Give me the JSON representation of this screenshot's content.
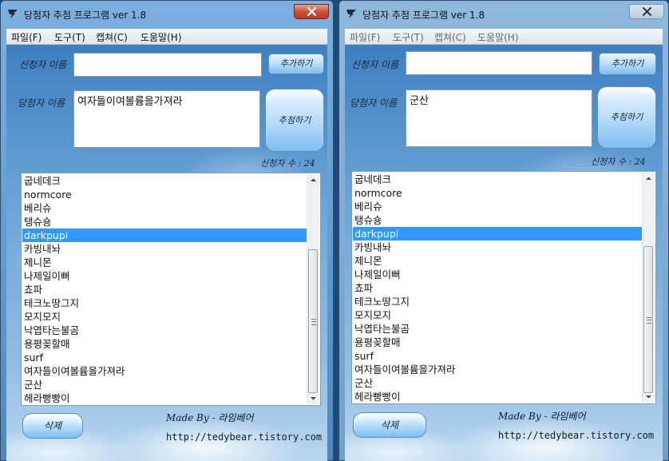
{
  "left_window": {
    "title": "당첨자 추첨 프로그램 ver 1.8",
    "menu": [
      "파일(F)",
      "도구(T)",
      "캡쳐(C)",
      "도움말(H)"
    ],
    "applicant_label": "신청자 이름",
    "applicant_value": "",
    "add_button": "추가하기",
    "winner_label": "당첨자 이름",
    "winner_value": "여자들이여볼륨을가져라",
    "draw_button": "추첨하기",
    "count_text": "신청자 수 : 24",
    "list_items": [
      "굽네데크",
      "normcore",
      "베리슈",
      "탱슈숑",
      "darkpupl",
      "카빙내놔",
      "제니몬",
      "나제일이뻐",
      "쵸파",
      "테크노땅그지",
      "모지모지",
      "낙엽타는불곰",
      "용평꽂할매",
      "surf",
      "여자들이여볼륨을가져라",
      "군산",
      "헤라빵빵이"
    ],
    "selected_index": 4,
    "delete_button": "삭제",
    "made_by": "Made By - 라임베어",
    "url": "http://tedybear.tistory.com"
  },
  "right_window": {
    "title": "당첨자 추첨 프로그램 ver 1.8",
    "menu": [
      "파일(F)",
      "도구(T)",
      "캡쳐(C)",
      "도움말(H)"
    ],
    "applicant_label": "신청자 이름",
    "applicant_value": "",
    "add_button": "추가하기",
    "winner_label": "당첨자 이름",
    "winner_value": "군산",
    "draw_button": "추첨하기",
    "count_text": "신청자 수 : 24",
    "list_items": [
      "굽네데크",
      "normcore",
      "베리슈",
      "탱슈숑",
      "darkpupl",
      "카빙내놔",
      "제니몬",
      "나제일이뻐",
      "쵸파",
      "테크노땅그지",
      "모지모지",
      "낙엽타는불곰",
      "용평꽂할매",
      "surf",
      "여자들이여볼륨을가져라",
      "군산",
      "헤라빵빵이"
    ],
    "selected_index": 4,
    "delete_button": "삭제",
    "made_by": "Made By - 라임베어",
    "url": "http://tedybear.tistory.com"
  },
  "colors": {
    "selection": "#3399ff",
    "close_active": "#c8452f",
    "frame_active": "#5b94cc",
    "frame_inactive": "#8fb8dc"
  },
  "icons": {
    "app": "tornado-app-icon",
    "close": "close-icon"
  }
}
